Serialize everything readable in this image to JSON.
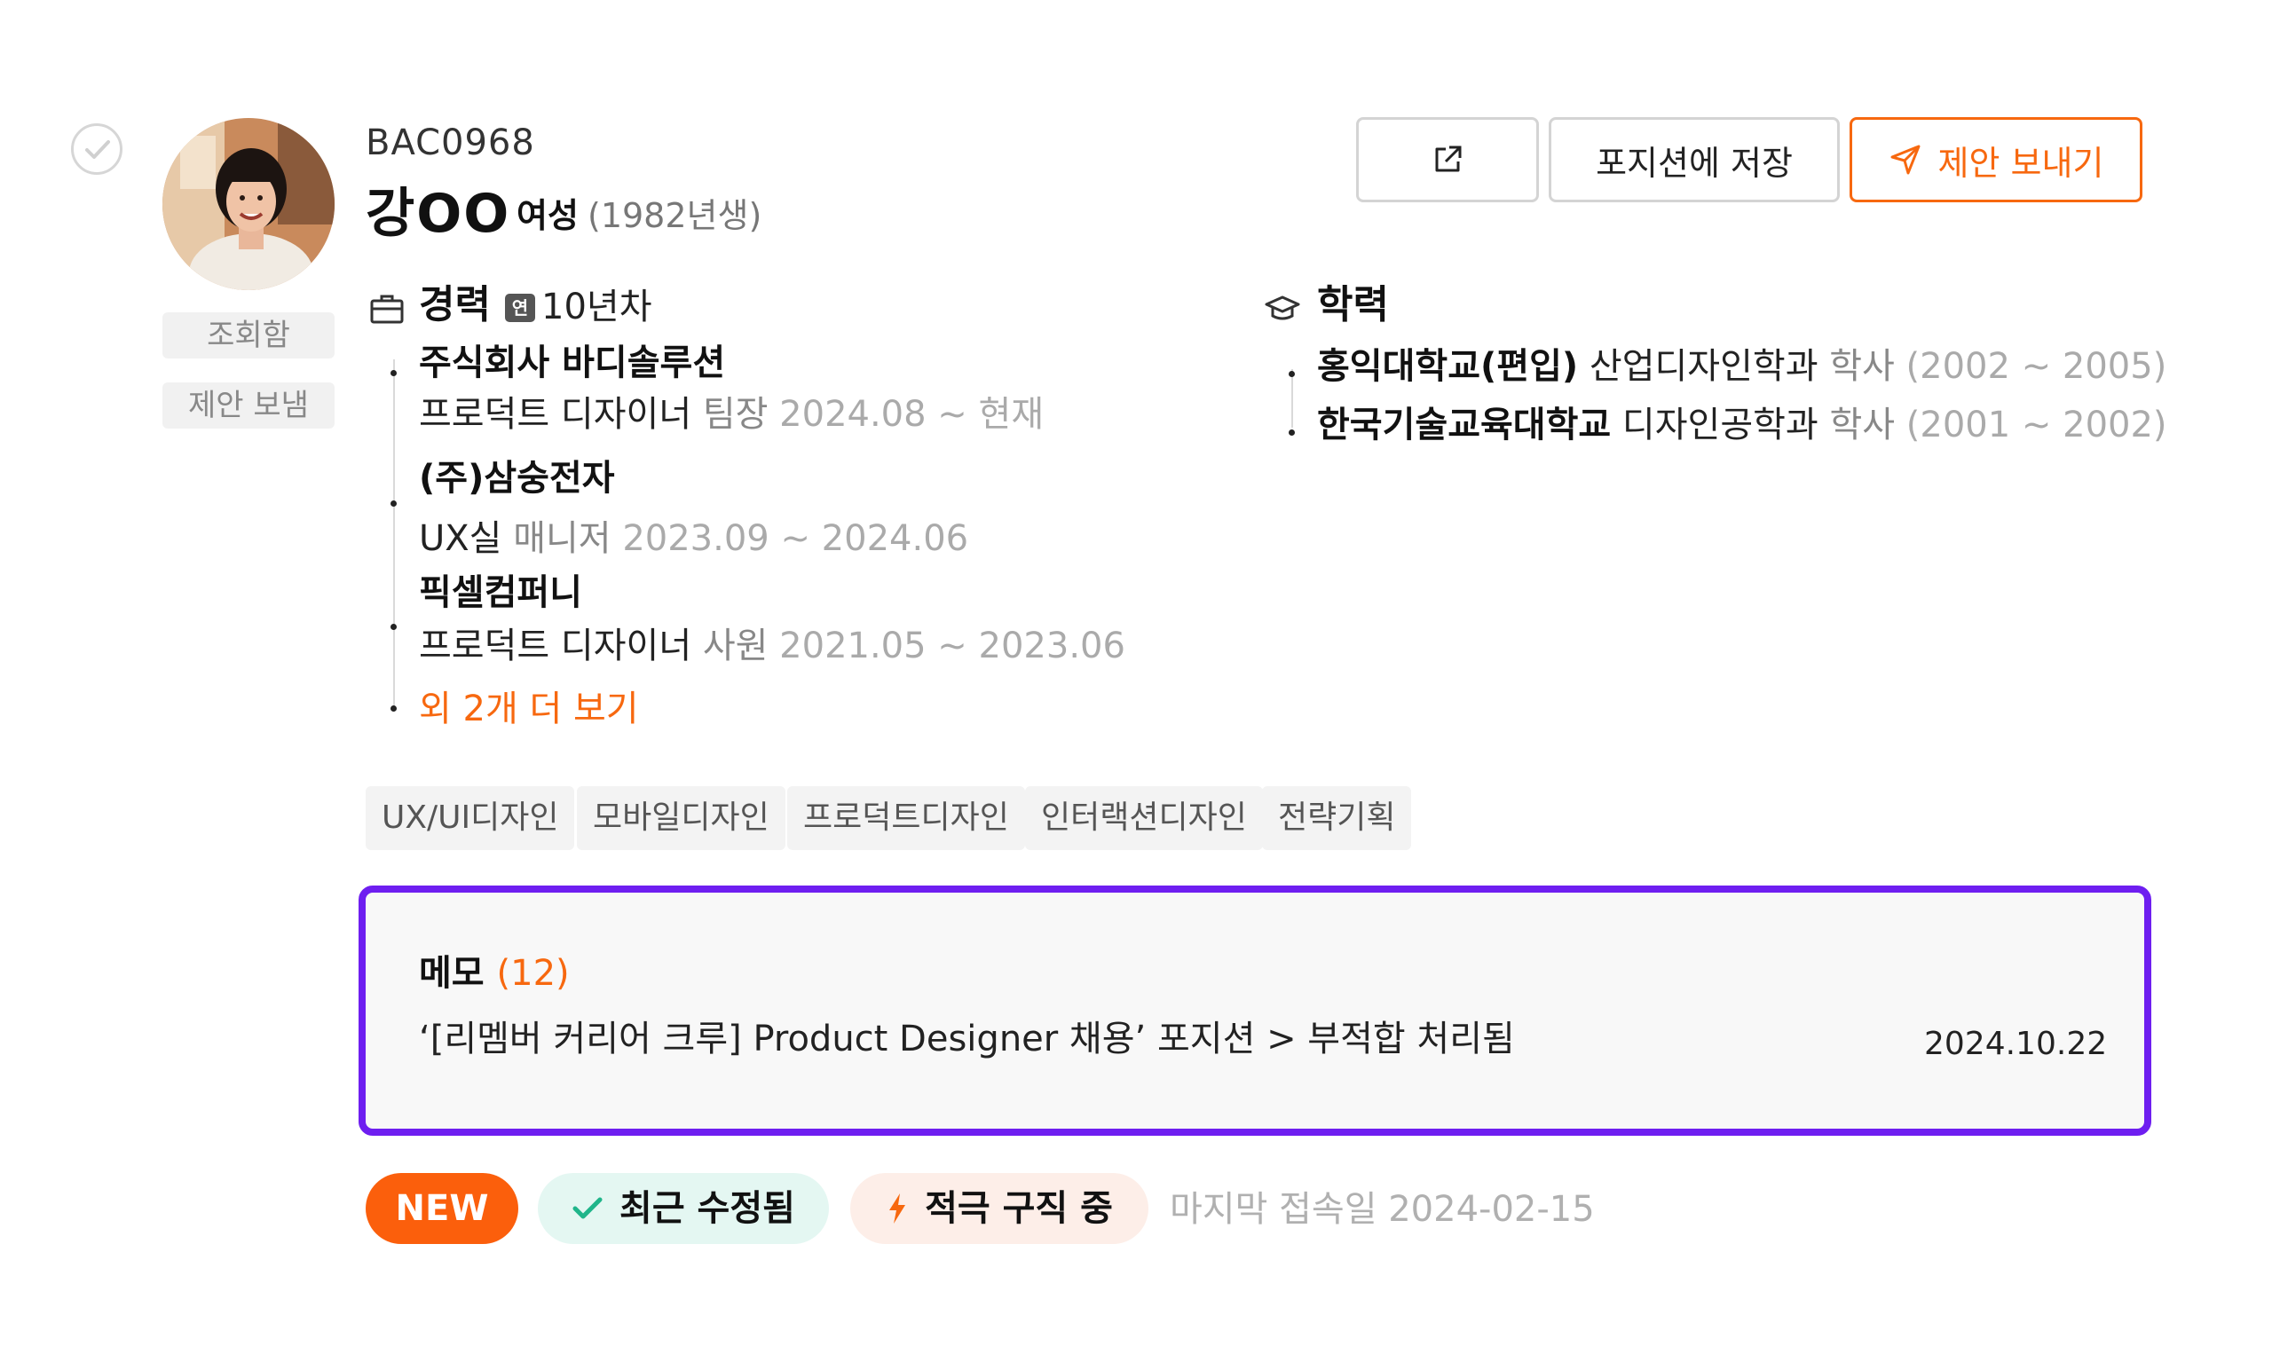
{
  "candidate": {
    "id": "BAC0968",
    "name": "강OO",
    "gender": "여성",
    "birth": "(1982년생)",
    "status_tags": [
      "조회함",
      "제안 보냄"
    ]
  },
  "actions": {
    "share_icon": "external-link-icon",
    "save_label": "포지션에 저장",
    "offer_label": "제안 보내기",
    "offer_icon": "paper-plane-icon"
  },
  "career": {
    "title": "경력",
    "badge": "연",
    "years": "10년차",
    "items": [
      {
        "company": "주식회사 바디솔루션",
        "role": "프로덕트 디자이너",
        "rank": "팀장",
        "period": "2024.08 ~ 현재"
      },
      {
        "company": "(주)삼숭전자",
        "role": "UX실",
        "rank": "매니저",
        "period": "2023.09 ~ 2024.06"
      },
      {
        "company": "픽셀컴퍼니",
        "role": "프로덕트 디자이너",
        "rank": "사원",
        "period": "2021.05 ~ 2023.06"
      }
    ],
    "more_label": "외 2개 더 보기"
  },
  "education": {
    "title": "학력",
    "items": [
      {
        "school": "홍익대학교(편입)",
        "major": "산업디자인학과",
        "degree": "학사",
        "period": "(2002 ~ 2005)"
      },
      {
        "school": "한국기술교육대학교",
        "major": "디자인공학과",
        "degree": "학사",
        "period": "(2001 ~ 2002)"
      }
    ]
  },
  "skills": [
    "UX/UI디자인",
    "모바일디자인",
    "프로덕트디자인",
    "인터랙션디자인",
    "전략기획"
  ],
  "memo": {
    "title": "메모",
    "count": "(12)",
    "text": "‘[리멤버 커리어 크루] Product Designer 채용’ 포지션 > 부적합 처리됨",
    "date": "2024.10.22"
  },
  "badges": {
    "new": "NEW",
    "edited": "최근 수정됨",
    "active": "적극 구직 중",
    "last_login": "마지막 접속일 2024-02-15"
  },
  "colors": {
    "accent": "#f7680f",
    "memo_border": "#6e1ef0",
    "edited_bg": "#e4f7f2",
    "edited_check": "#1fb58a",
    "active_bg": "#fdeee8"
  }
}
